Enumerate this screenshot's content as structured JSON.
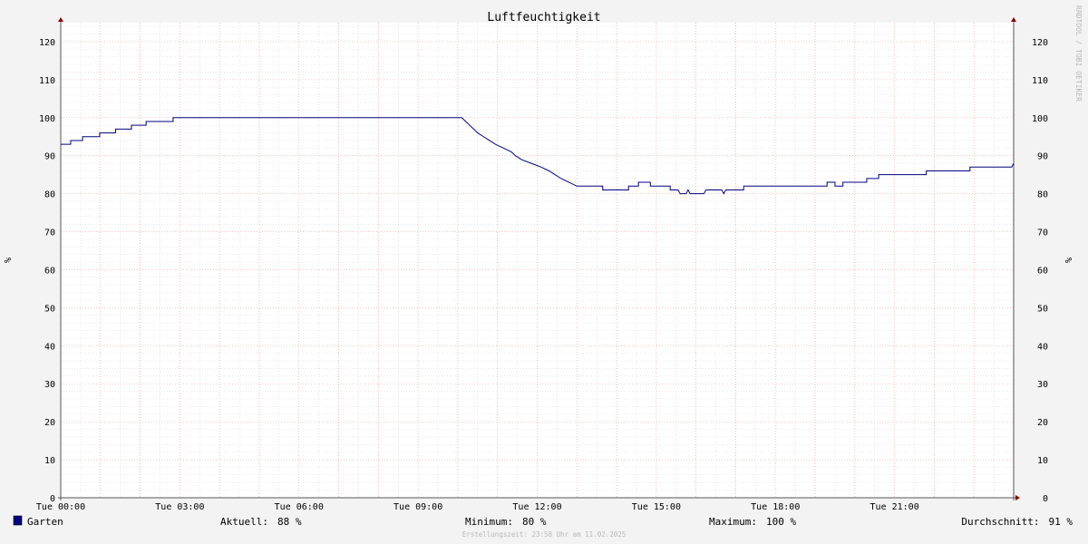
{
  "colors": {
    "background": "#f3f3f3",
    "canvas": "#ffffff",
    "grid_minor": "#d4d4d4",
    "grid_major": "#f0a0a0",
    "axis": "#8b0000",
    "line": "#000080",
    "text": "#000000",
    "watermark": "#b8b8b8"
  },
  "watermark": "RRDTOOL / TOBI OETIKER",
  "footer": "Erstellungszeit: 23:58 Uhr am 11.02.2025",
  "chart_data": {
    "type": "line",
    "title": "Luftfeuchtigkeit",
    "ylabel": "%",
    "ylabel_right": "%",
    "ylim": [
      0,
      125
    ],
    "yticks": [
      0,
      10,
      20,
      30,
      40,
      50,
      60,
      70,
      80,
      90,
      100,
      110,
      120
    ],
    "xlim": [
      0,
      24
    ],
    "xtick_labels": [
      {
        "x": 0,
        "label": "Tue 00:00"
      },
      {
        "x": 3,
        "label": "Tue 03:00"
      },
      {
        "x": 6,
        "label": "Tue 06:00"
      },
      {
        "x": 9,
        "label": "Tue 09:00"
      },
      {
        "x": 12,
        "label": "Tue 12:00"
      },
      {
        "x": 15,
        "label": "Tue 15:00"
      },
      {
        "x": 18,
        "label": "Tue 18:00"
      },
      {
        "x": 21,
        "label": "Tue 21:00"
      }
    ],
    "grid": true,
    "series": [
      {
        "name": "Garten",
        "color": "#000080",
        "points": [
          [
            0.0,
            93
          ],
          [
            0.25,
            93
          ],
          [
            0.25,
            94
          ],
          [
            0.55,
            94
          ],
          [
            0.55,
            95
          ],
          [
            0.98,
            95
          ],
          [
            0.98,
            96
          ],
          [
            1.38,
            96
          ],
          [
            1.38,
            97
          ],
          [
            1.78,
            97
          ],
          [
            1.78,
            98
          ],
          [
            2.15,
            98
          ],
          [
            2.15,
            99
          ],
          [
            2.83,
            99
          ],
          [
            2.83,
            100
          ],
          [
            10.1,
            100
          ],
          [
            10.2,
            99
          ],
          [
            10.3,
            98
          ],
          [
            10.4,
            97
          ],
          [
            10.5,
            96
          ],
          [
            10.65,
            95
          ],
          [
            10.8,
            94
          ],
          [
            10.95,
            93
          ],
          [
            11.15,
            92
          ],
          [
            11.35,
            91
          ],
          [
            11.45,
            90
          ],
          [
            11.6,
            89
          ],
          [
            11.85,
            88
          ],
          [
            12.1,
            87
          ],
          [
            12.3,
            86
          ],
          [
            12.45,
            85
          ],
          [
            12.6,
            84
          ],
          [
            12.8,
            83
          ],
          [
            13.0,
            82
          ],
          [
            13.65,
            82
          ],
          [
            13.65,
            81
          ],
          [
            14.3,
            81
          ],
          [
            14.3,
            82
          ],
          [
            14.55,
            82
          ],
          [
            14.55,
            83
          ],
          [
            14.85,
            83
          ],
          [
            14.85,
            82
          ],
          [
            15.35,
            82
          ],
          [
            15.35,
            81
          ],
          [
            15.55,
            81
          ],
          [
            15.6,
            80
          ],
          [
            15.75,
            80
          ],
          [
            15.8,
            81
          ],
          [
            15.85,
            80
          ],
          [
            16.2,
            80
          ],
          [
            16.25,
            81
          ],
          [
            16.65,
            81
          ],
          [
            16.7,
            80
          ],
          [
            16.75,
            81
          ],
          [
            17.2,
            81
          ],
          [
            17.2,
            82
          ],
          [
            19.3,
            82
          ],
          [
            19.3,
            83
          ],
          [
            19.5,
            83
          ],
          [
            19.5,
            82
          ],
          [
            19.7,
            82
          ],
          [
            19.7,
            83
          ],
          [
            20.3,
            83
          ],
          [
            20.3,
            84
          ],
          [
            20.6,
            84
          ],
          [
            20.6,
            85
          ],
          [
            21.8,
            85
          ],
          [
            21.8,
            86
          ],
          [
            22.9,
            86
          ],
          [
            22.9,
            87
          ],
          [
            23.95,
            87
          ],
          [
            24.0,
            88
          ]
        ]
      }
    ],
    "legend": {
      "placement": "bottom",
      "series_name": "Garten",
      "stats": [
        {
          "label": "Aktuell:",
          "value": "88 %"
        },
        {
          "label": "Minimum:",
          "value": "80 %"
        },
        {
          "label": "Maximum:",
          "value": "100 %"
        },
        {
          "label": "Durchschnitt:",
          "value": "91 %"
        }
      ]
    }
  }
}
